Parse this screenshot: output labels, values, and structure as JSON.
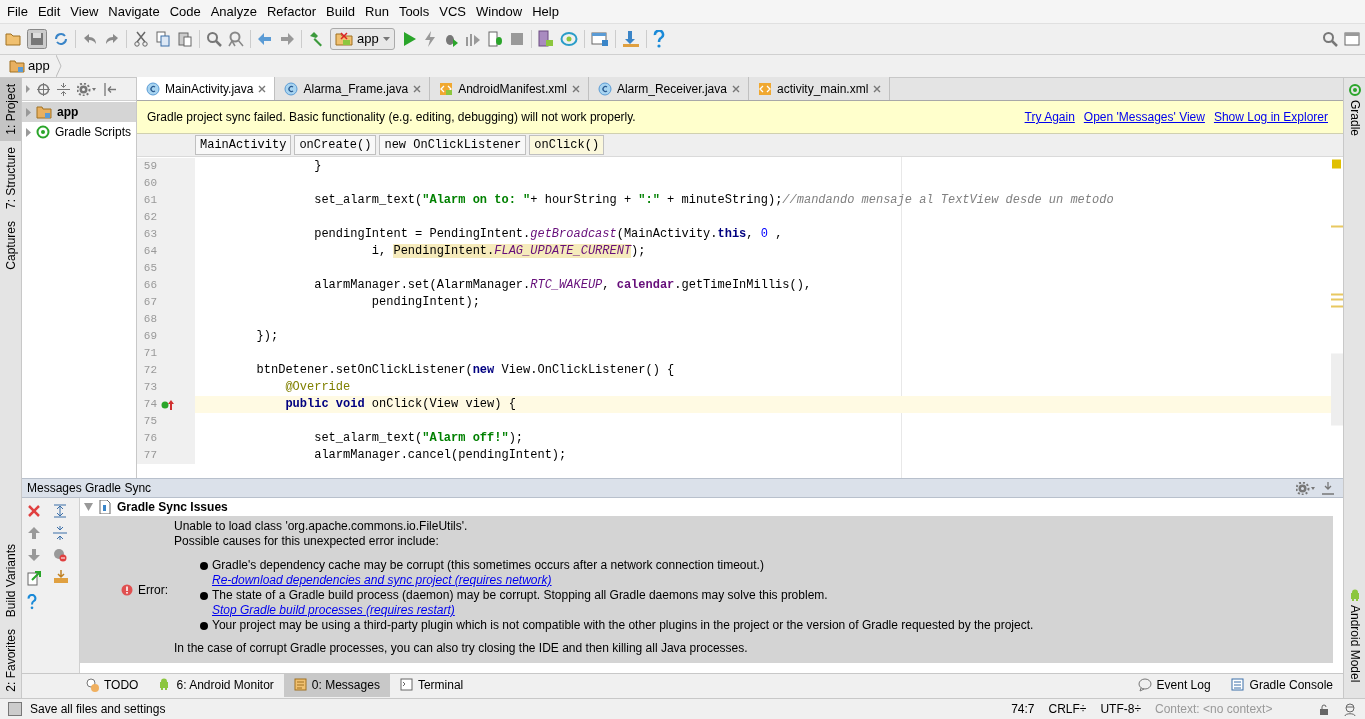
{
  "menu": [
    "File",
    "Edit",
    "View",
    "Navigate",
    "Code",
    "Analyze",
    "Refactor",
    "Build",
    "Run",
    "Tools",
    "VCS",
    "Window",
    "Help"
  ],
  "toolbar": {
    "run_config": "app"
  },
  "navbar": {
    "crumb": "app"
  },
  "left_stripe": {
    "top": [
      {
        "label": "1: Project",
        "selected": true
      },
      {
        "label": "7: Structure",
        "selected": false
      },
      {
        "label": "Captures",
        "selected": false
      }
    ],
    "bottom": [
      {
        "label": "Build Variants",
        "selected": false
      },
      {
        "label": "2: Favorites",
        "selected": false
      }
    ]
  },
  "right_stripe": {
    "top": [
      {
        "label": "Gradle"
      }
    ],
    "bottom": [
      {
        "label": "Android Model"
      }
    ]
  },
  "project_tree": [
    {
      "label": "app",
      "selected": true,
      "kind": "module"
    },
    {
      "label": "Gradle Scripts",
      "selected": false,
      "kind": "gradle"
    }
  ],
  "editor_tabs": [
    {
      "label": "MainActivity.java",
      "kind": "class",
      "selected": true
    },
    {
      "label": "Alarma_Frame.java",
      "kind": "class",
      "selected": false
    },
    {
      "label": "AndroidManifest.xml",
      "kind": "manifest",
      "selected": false
    },
    {
      "label": "Alarm_Receiver.java",
      "kind": "class",
      "selected": false
    },
    {
      "label": "activity_main.xml",
      "kind": "xml",
      "selected": false
    }
  ],
  "banner": {
    "message": "Gradle project sync failed. Basic functionality (e.g. editing, debugging) will not work properly.",
    "links": [
      "Try Again",
      "Open 'Messages' View",
      "Show Log in Explorer"
    ]
  },
  "breadcrumbs": [
    {
      "label": "MainActivity",
      "selected": false
    },
    {
      "label": "onCreate()",
      "selected": false
    },
    {
      "label": "new OnClickListener",
      "selected": false
    },
    {
      "label": "onClick()",
      "selected": true
    }
  ],
  "code_lines": [
    {
      "number": "59",
      "current": false,
      "segments": [
        {
          "kind": "plain",
          "text": "                }"
        }
      ]
    },
    {
      "number": "60",
      "current": false
    },
    {
      "number": "61",
      "current": false,
      "segments": [
        {
          "kind": "plain",
          "text": "                set_alarm_text("
        },
        {
          "kind": "string",
          "text": "\"Alarm on to: \""
        },
        {
          "kind": "plain",
          "text": "+ hourString + "
        },
        {
          "kind": "string",
          "text": "\":\""
        },
        {
          "kind": "plain",
          "text": " + minuteString);"
        },
        {
          "kind": "comment",
          "text": "//mandando mensaje al TextView desde un metodo"
        }
      ]
    },
    {
      "number": "62",
      "current": false
    },
    {
      "number": "63",
      "current": false,
      "segments": [
        {
          "kind": "plain",
          "text": "                pendingIntent = PendingIntent."
        },
        {
          "kind": "static",
          "text": "getBroadcast"
        },
        {
          "kind": "plain",
          "text": "(MainActivity."
        },
        {
          "kind": "keyword",
          "text": "this"
        },
        {
          "kind": "plain",
          "text": ", "
        },
        {
          "kind": "number",
          "text": "0"
        },
        {
          "kind": "plain",
          "text": " ,"
        }
      ]
    },
    {
      "number": "64",
      "current": false,
      "segments": [
        {
          "kind": "plain",
          "text": "                        i, "
        },
        {
          "kind": "plain_hl",
          "text": "PendingIntent."
        },
        {
          "kind": "static_hl",
          "text": "FLAG_UPDATE_CURRENT"
        },
        {
          "kind": "plain",
          "text": ");"
        }
      ]
    },
    {
      "number": "65",
      "current": false
    },
    {
      "number": "66",
      "current": false,
      "segments": [
        {
          "kind": "plain",
          "text": "                alarmManager.set(AlarmManager."
        },
        {
          "kind": "static",
          "text": "RTC_WAKEUP"
        },
        {
          "kind": "plain",
          "text": ", "
        },
        {
          "kind": "field",
          "text": "calendar"
        },
        {
          "kind": "plain",
          "text": ".getTimeInMillis(),"
        }
      ]
    },
    {
      "number": "67",
      "current": false,
      "segments": [
        {
          "kind": "plain",
          "text": "                        pendingIntent);"
        }
      ]
    },
    {
      "number": "68",
      "current": false
    },
    {
      "number": "69",
      "current": false,
      "segments": [
        {
          "kind": "plain",
          "text": "        });"
        }
      ]
    },
    {
      "number": "71",
      "current": false
    },
    {
      "number": "72",
      "current": false,
      "segments": [
        {
          "kind": "plain",
          "text": "        btnDetener.setOnClickListener("
        },
        {
          "kind": "keyword",
          "text": "new"
        },
        {
          "kind": "plain",
          "text": " View.OnClickListener() {"
        }
      ]
    },
    {
      "number": "73",
      "current": false,
      "segments": [
        {
          "kind": "annotation",
          "text": "            @Override"
        }
      ]
    },
    {
      "number": "74",
      "current": true,
      "override_marker": true,
      "segments": [
        {
          "kind": "keyword",
          "text": "            public void"
        },
        {
          "kind": "plain",
          "text": " onClick(View view) {"
        }
      ]
    },
    {
      "number": "75",
      "current": false
    },
    {
      "number": "76",
      "current": false,
      "segments": [
        {
          "kind": "plain",
          "text": "                set_alarm_text("
        },
        {
          "kind": "string",
          "text": "\"Alarm off!\""
        },
        {
          "kind": "plain",
          "text": ");"
        }
      ]
    },
    {
      "number": "77",
      "current": false,
      "segments": [
        {
          "kind": "plain",
          "text": "                alarmManager.cancel(pendingIntent);"
        }
      ]
    }
  ],
  "messages": {
    "title": "Messages Gradle Sync",
    "group": "Gradle Sync Issues",
    "expanded": true,
    "severity": "Error:",
    "intro": [
      "Unable to load class 'org.apache.commons.io.FileUtils'.",
      "Possible causes for this unexpected error include:"
    ],
    "bullets": [
      {
        "text": "Gradle's dependency cache may be corrupt (this sometimes occurs after a network connection timeout.)",
        "link": "Re-download dependencies and sync project (requires network)"
      },
      {
        "text": "The state of a Gradle build process (daemon) may be corrupt. Stopping all Gradle daemons may solve this problem.",
        "link": "Stop Gradle build processes (requires restart)"
      },
      {
        "text": "Your project may be using a third-party plugin which is not compatible with the other plugins in the project or the version of Gradle requested by the project."
      }
    ],
    "footer": "In the case of corrupt Gradle processes, you can also try closing the IDE and then killing all Java processes."
  },
  "bottom_tabs": [
    {
      "label": "TODO",
      "kind": "todo",
      "selected": false
    },
    {
      "label": "6: Android Monitor",
      "kind": "android",
      "selected": false
    },
    {
      "label": "0: Messages",
      "kind": "messages",
      "selected": true
    },
    {
      "label": "Terminal",
      "kind": "terminal",
      "selected": false
    }
  ],
  "bottom_right_tabs": [
    {
      "label": "Event Log",
      "kind": "bubble"
    },
    {
      "label": "Gradle Console",
      "kind": "console"
    }
  ],
  "status_bar": {
    "message": "Save all files and settings",
    "position": "74:7",
    "line_separator": "CRLF÷",
    "encoding": "UTF-8÷",
    "context": "Context: <no context>"
  }
}
